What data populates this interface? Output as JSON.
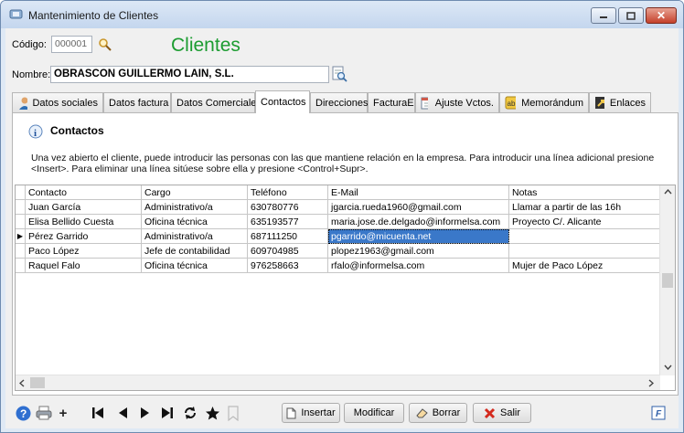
{
  "window": {
    "title": "Mantenimiento de Clientes",
    "close_glyph": "✕"
  },
  "header": {
    "codigo_label": "Código:",
    "codigo_value": "000001",
    "heading": "Clientes",
    "nombre_label": "Nombre:",
    "nombre_value": "OBRASCON GUILLERMO LAIN, S.L."
  },
  "tabs": [
    {
      "label": "Datos sociales",
      "icon": "person-icon"
    },
    {
      "label": "Datos factura"
    },
    {
      "label": "Datos Comerciales"
    },
    {
      "label": "Contactos",
      "active": true
    },
    {
      "label": "Direcciones"
    },
    {
      "label": "FacturaE"
    },
    {
      "label": "Ajuste Vctos.",
      "icon": "calendar-icon"
    },
    {
      "label": "Memorándum",
      "icon": "notepad-icon"
    },
    {
      "label": "Enlaces",
      "icon": "shortcut-icon"
    }
  ],
  "contactos": {
    "title": "Contactos",
    "info_glyph": "i",
    "description": "Una vez abierto el cliente, puede introducir las personas con las que mantiene relación en la empresa. Para introducir una línea adicional presione <Insert>. Para eliminar una línea sitúese sobre ella y presione <Control+Supr>.",
    "columns": [
      "Contacto",
      "Cargo",
      "Teléfono",
      "E-Mail",
      "Notas"
    ],
    "rows": [
      [
        "Juan García",
        "Administrativo/a",
        "630780776",
        "jgarcia.rueda1960@gmail.com",
        "Llamar a partir de las 16h"
      ],
      [
        "Elisa Bellido Cuesta",
        "Oficina técnica",
        "635193577",
        "maria.jose.de.delgado@informelsa.com",
        "Proyecto C/. Alicante"
      ],
      [
        "Pérez Garrido",
        "Administrativo/a",
        "687111250",
        "pgarrido@micuenta.net",
        ""
      ],
      [
        "Paco López",
        "Jefe de contabilidad",
        "609704985",
        "plopez1963@gmail.com",
        ""
      ],
      [
        "Raquel Falo",
        "Oficina técnica",
        "976258663",
        "rfalo@informelsa.com",
        "Mujer de Paco López"
      ]
    ],
    "selected_row": 2,
    "row_indicator": "▶"
  },
  "toolbar": {
    "insertar": "Insertar",
    "modificar": "Modificar",
    "borrar": "Borrar",
    "salir": "Salir",
    "add_glyph": "+",
    "f_glyph": "F"
  },
  "colors": {
    "heading": "#1c9c31",
    "selection": "#3a78c9"
  }
}
